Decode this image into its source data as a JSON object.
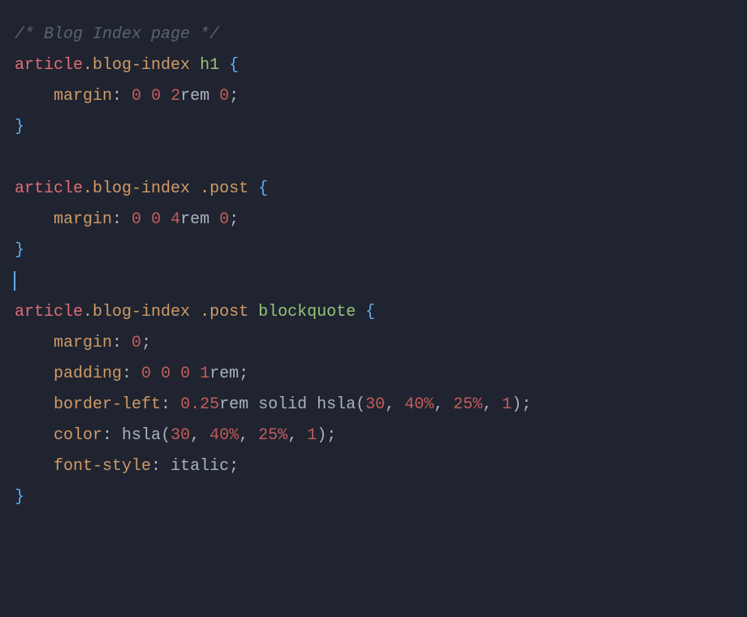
{
  "code": {
    "comment": "/* Blog Index page */",
    "indent": "    ",
    "rule1": {
      "sel_tag": "article",
      "sel_class": ".blog-index",
      "sel_el": "h1",
      "prop": "margin",
      "v1": "0",
      "v2": "0",
      "v3": "2",
      "unit": "rem",
      "v4": "0"
    },
    "rule2": {
      "sel_tag": "article",
      "sel_class1": ".blog-index",
      "sel_class2": ".post",
      "prop": "margin",
      "v1": "0",
      "v2": "0",
      "v3": "4",
      "unit": "rem",
      "v4": "0"
    },
    "rule3": {
      "sel_tag": "article",
      "sel_class1": ".blog-index",
      "sel_class2": ".post",
      "sel_el": "blockquote",
      "margin_prop": "margin",
      "margin_val": "0",
      "padding_prop": "padding",
      "p1": "0",
      "p2": "0",
      "p3": "0",
      "p4": "1",
      "p_unit": "rem",
      "border_prop": "border-left",
      "border_w": "0.25",
      "border_unit": "rem",
      "border_style": "solid",
      "hsla_fn": "hsla",
      "h": "30",
      "s": "40",
      "l": "25",
      "a": "1",
      "pct": "%",
      "color_prop": "color",
      "fontstyle_prop": "font-style",
      "fontstyle_val": "italic"
    }
  }
}
